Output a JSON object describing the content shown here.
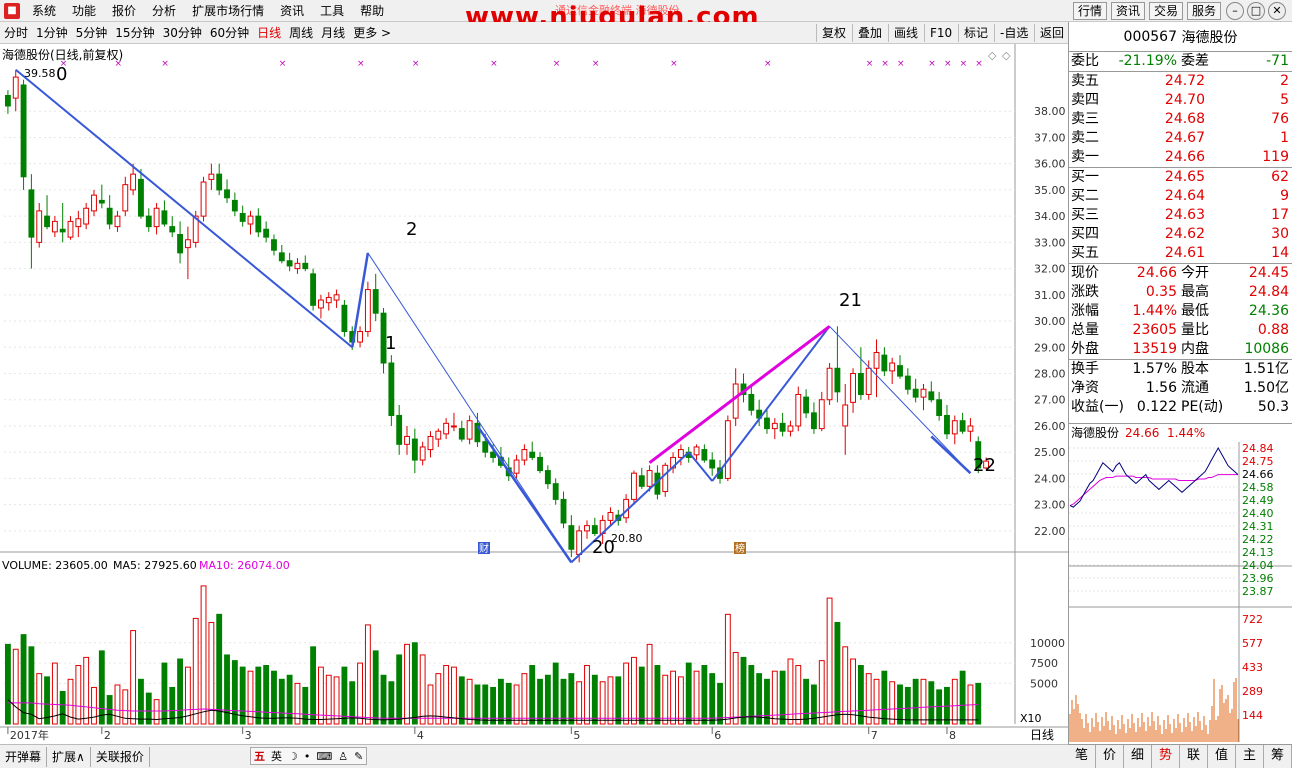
{
  "menu": {
    "items": [
      "系统",
      "功能",
      "报价",
      "分析",
      "扩展市场行情",
      "资讯",
      "工具",
      "帮助"
    ]
  },
  "watermark": "www.niugulan.com",
  "watermark_sub": "通达信金融终端   海德股份",
  "top_right": {
    "buttons": [
      "行情",
      "资讯",
      "交易",
      "服务"
    ]
  },
  "periods": {
    "items": [
      "分时",
      "1分钟",
      "5分钟",
      "15分钟",
      "30分钟",
      "60分钟",
      "日线",
      "周线",
      "月线",
      "更多 >"
    ],
    "active": "日线"
  },
  "toolbar": {
    "items": [
      "复权",
      "叠加",
      "画线",
      "F10",
      "标记",
      "-自选",
      "返回"
    ]
  },
  "chart": {
    "title": "海德股份(日线,前复权)",
    "high_label": "39.58",
    "low_label": "20.80",
    "y_ticks": [
      "38.00",
      "37.00",
      "36.00",
      "35.00",
      "34.00",
      "33.00",
      "32.00",
      "31.00",
      "30.00",
      "29.00",
      "28.00",
      "27.00",
      "26.00",
      "25.00",
      "24.00",
      "23.00",
      "22.00"
    ],
    "x_labels": [
      "2017年",
      "2",
      "3",
      "4",
      "5",
      "6",
      "7",
      "8"
    ],
    "wave_labels": [
      "0",
      "1",
      "2",
      "20",
      "21",
      "22"
    ],
    "volume_legend": {
      "vol": "VOLUME: 23605.00",
      "ma5": "MA5: 27925.60",
      "ma10": "MA10: 26074.00"
    },
    "volume_ticks": [
      "10000",
      "7500",
      "5000"
    ],
    "volume_unit": "X10",
    "period_label": "日线",
    "markers": {
      "cai": "财",
      "bang": "榜"
    },
    "colors": {
      "up": "#e00000",
      "down": "#008000",
      "wave": "#3858d8",
      "pink": "#e000e0",
      "ma5": "#000000",
      "ma10": "#e000e0"
    }
  },
  "chart_data": {
    "type": "candlestick",
    "ylim": [
      21.5,
      39.8
    ],
    "candles": [
      [
        38.6,
        38.8,
        37.9,
        38.2
      ],
      [
        38.5,
        39.58,
        38.0,
        39.3
      ],
      [
        39.0,
        39.2,
        35.0,
        35.5
      ],
      [
        35.0,
        35.6,
        32.0,
        33.2
      ],
      [
        33.0,
        34.5,
        32.8,
        34.2
      ],
      [
        34.0,
        34.8,
        33.5,
        33.6
      ],
      [
        33.4,
        34.0,
        33.2,
        33.8
      ],
      [
        33.5,
        34.5,
        33.0,
        33.4
      ],
      [
        33.2,
        34.0,
        33.1,
        33.8
      ],
      [
        33.6,
        34.2,
        33.2,
        33.9
      ],
      [
        33.7,
        34.5,
        33.5,
        34.3
      ],
      [
        34.2,
        35.0,
        34.0,
        34.8
      ],
      [
        34.6,
        35.2,
        34.3,
        34.5
      ],
      [
        34.3,
        34.8,
        33.5,
        33.7
      ],
      [
        33.6,
        34.2,
        33.4,
        34.0
      ],
      [
        34.2,
        35.5,
        34.0,
        35.2
      ],
      [
        35.0,
        36.0,
        34.8,
        35.6
      ],
      [
        35.4,
        35.8,
        33.9,
        34.0
      ],
      [
        34.0,
        34.3,
        33.4,
        33.6
      ],
      [
        33.6,
        34.5,
        33.3,
        34.3
      ],
      [
        34.2,
        34.6,
        33.6,
        33.7
      ],
      [
        33.6,
        34.0,
        33.2,
        33.4
      ],
      [
        33.3,
        33.8,
        32.2,
        32.6
      ],
      [
        32.8,
        33.6,
        31.6,
        33.1
      ],
      [
        33.0,
        34.2,
        32.8,
        34.0
      ],
      [
        34.0,
        35.5,
        33.8,
        35.3
      ],
      [
        35.4,
        36.0,
        35.0,
        35.6
      ],
      [
        35.6,
        36.0,
        34.8,
        35.0
      ],
      [
        35.0,
        35.4,
        34.5,
        34.7
      ],
      [
        34.6,
        34.9,
        34.0,
        34.2
      ],
      [
        34.1,
        34.4,
        33.6,
        33.8
      ],
      [
        33.7,
        34.2,
        33.3,
        34.0
      ],
      [
        34.0,
        34.3,
        33.2,
        33.4
      ],
      [
        33.5,
        33.8,
        33.0,
        33.2
      ],
      [
        33.1,
        33.3,
        32.5,
        32.7
      ],
      [
        32.6,
        32.9,
        32.2,
        32.3
      ],
      [
        32.3,
        32.6,
        31.9,
        32.1
      ],
      [
        32.0,
        32.4,
        31.8,
        32.2
      ],
      [
        32.2,
        32.5,
        31.9,
        32.0
      ],
      [
        31.8,
        32.0,
        30.4,
        30.6
      ],
      [
        30.5,
        31.0,
        30.1,
        30.8
      ],
      [
        30.7,
        31.1,
        30.4,
        30.9
      ],
      [
        30.8,
        31.2,
        30.5,
        31.0
      ],
      [
        30.6,
        30.8,
        29.4,
        29.6
      ],
      [
        29.6,
        29.8,
        28.9,
        29.2
      ],
      [
        29.2,
        29.8,
        29.0,
        29.6
      ],
      [
        29.6,
        31.5,
        29.4,
        31.2
      ],
      [
        31.2,
        31.8,
        30.0,
        30.3
      ],
      [
        30.3,
        30.5,
        28.0,
        28.4
      ],
      [
        28.4,
        28.7,
        26.0,
        26.4
      ],
      [
        26.4,
        26.8,
        24.9,
        25.3
      ],
      [
        25.3,
        26.0,
        24.9,
        25.6
      ],
      [
        25.5,
        25.9,
        24.2,
        24.7
      ],
      [
        24.7,
        25.4,
        24.5,
        25.2
      ],
      [
        25.1,
        25.8,
        24.8,
        25.6
      ],
      [
        25.5,
        25.9,
        25.2,
        25.8
      ],
      [
        25.7,
        26.3,
        25.5,
        26.1
      ],
      [
        26.0,
        26.5,
        25.8,
        26.0
      ],
      [
        25.9,
        26.2,
        25.4,
        25.5
      ],
      [
        25.5,
        26.4,
        25.3,
        26.2
      ],
      [
        26.1,
        26.5,
        25.2,
        25.4
      ],
      [
        25.4,
        25.7,
        24.8,
        25.0
      ],
      [
        25.0,
        25.3,
        24.6,
        24.8
      ],
      [
        24.8,
        25.2,
        24.4,
        24.5
      ],
      [
        24.4,
        24.8,
        23.9,
        24.1
      ],
      [
        24.2,
        24.9,
        24.0,
        24.7
      ],
      [
        24.7,
        25.3,
        24.5,
        25.1
      ],
      [
        25.0,
        25.4,
        24.7,
        24.8
      ],
      [
        24.8,
        25.0,
        24.2,
        24.3
      ],
      [
        24.3,
        24.5,
        23.6,
        23.8
      ],
      [
        23.8,
        24.0,
        23.0,
        23.2
      ],
      [
        23.2,
        23.5,
        22.1,
        22.3
      ],
      [
        22.2,
        22.6,
        21.0,
        21.3
      ],
      [
        21.1,
        22.2,
        20.8,
        22.0
      ],
      [
        22.0,
        22.4,
        21.7,
        22.2
      ],
      [
        22.2,
        22.5,
        21.8,
        21.9
      ],
      [
        21.9,
        22.6,
        21.5,
        22.4
      ],
      [
        22.4,
        22.9,
        22.2,
        22.7
      ],
      [
        22.6,
        22.8,
        22.2,
        22.4
      ],
      [
        22.5,
        23.4,
        22.3,
        23.2
      ],
      [
        23.2,
        24.3,
        23.0,
        24.2
      ],
      [
        24.1,
        24.4,
        23.6,
        23.7
      ],
      [
        23.7,
        24.5,
        23.5,
        24.3
      ],
      [
        24.2,
        24.5,
        23.2,
        23.4
      ],
      [
        23.5,
        24.6,
        23.3,
        24.5
      ],
      [
        24.4,
        25.0,
        24.2,
        24.8
      ],
      [
        24.8,
        25.3,
        24.5,
        25.1
      ],
      [
        25.0,
        25.2,
        24.6,
        24.8
      ],
      [
        24.9,
        25.3,
        24.7,
        25.2
      ],
      [
        25.1,
        25.3,
        24.6,
        24.7
      ],
      [
        24.7,
        25.0,
        24.1,
        24.4
      ],
      [
        24.4,
        24.7,
        23.8,
        24.0
      ],
      [
        24.0,
        26.4,
        23.9,
        26.2
      ],
      [
        26.3,
        28.2,
        26.0,
        27.6
      ],
      [
        27.6,
        28.0,
        26.9,
        27.2
      ],
      [
        27.2,
        27.5,
        26.4,
        26.6
      ],
      [
        26.6,
        27.0,
        26.0,
        26.3
      ],
      [
        26.3,
        26.7,
        25.7,
        25.9
      ],
      [
        25.9,
        26.3,
        25.5,
        26.1
      ],
      [
        26.1,
        26.5,
        25.6,
        25.8
      ],
      [
        25.8,
        26.2,
        25.6,
        26.0
      ],
      [
        26.0,
        27.5,
        25.8,
        27.2
      ],
      [
        27.1,
        27.4,
        26.3,
        26.5
      ],
      [
        26.5,
        26.9,
        25.7,
        25.9
      ],
      [
        25.9,
        27.3,
        25.8,
        27.0
      ],
      [
        27.0,
        28.4,
        26.8,
        28.2
      ],
      [
        28.2,
        29.8,
        26.9,
        27.3
      ],
      [
        26.0,
        27.6,
        24.9,
        26.8
      ],
      [
        26.9,
        28.2,
        26.5,
        28.0
      ],
      [
        28.0,
        29.0,
        27.0,
        27.2
      ],
      [
        27.2,
        28.5,
        27.0,
        28.2
      ],
      [
        28.2,
        29.3,
        27.1,
        28.8
      ],
      [
        28.7,
        29.0,
        27.9,
        28.1
      ],
      [
        28.1,
        28.6,
        27.6,
        28.4
      ],
      [
        28.3,
        28.7,
        27.8,
        27.9
      ],
      [
        27.9,
        28.2,
        27.2,
        27.4
      ],
      [
        27.4,
        27.8,
        26.9,
        27.1
      ],
      [
        27.1,
        27.6,
        26.6,
        27.4
      ],
      [
        27.3,
        27.7,
        26.9,
        27.0
      ],
      [
        27.0,
        27.3,
        26.2,
        26.4
      ],
      [
        26.4,
        26.8,
        25.5,
        25.7
      ],
      [
        25.7,
        26.4,
        25.3,
        26.2
      ],
      [
        26.2,
        26.5,
        25.7,
        25.8
      ],
      [
        25.8,
        26.3,
        25.4,
        26.0
      ],
      [
        25.4,
        25.6,
        24.2,
        24.4
      ],
      [
        24.4,
        24.8,
        24.36,
        24.66
      ]
    ],
    "volume": [
      98,
      92,
      110,
      95,
      62,
      58,
      75,
      40,
      55,
      72,
      82,
      45,
      90,
      35,
      48,
      42,
      115,
      55,
      38,
      30,
      75,
      45,
      80,
      70,
      130,
      170,
      125,
      135,
      85,
      78,
      70,
      65,
      70,
      72,
      65,
      55,
      60,
      50,
      45,
      95,
      70,
      60,
      58,
      70,
      52,
      75,
      122,
      90,
      60,
      52,
      85,
      98,
      100,
      85,
      48,
      62,
      72,
      70,
      58,
      55,
      48,
      48,
      45,
      55,
      50,
      48,
      62,
      72,
      55,
      60,
      75,
      55,
      62,
      52,
      72,
      60,
      52,
      58,
      58,
      75,
      82,
      70,
      98,
      72,
      60,
      65,
      58,
      75,
      65,
      72,
      62,
      50,
      135,
      88,
      82,
      72,
      62,
      55,
      65,
      65,
      80,
      72,
      55,
      48,
      78,
      155,
      125,
      95,
      80,
      72,
      62,
      55,
      65,
      52,
      48,
      45,
      55,
      55,
      52,
      42,
      45,
      55,
      65,
      48,
      50
    ],
    "ma5": [
      30.0,
      21.0,
      14.0,
      12.0,
      6.5,
      8.0,
      10.0,
      12.5,
      8.5,
      6.0,
      7.0,
      8.5,
      11.0,
      12.0,
      9.5,
      7.0,
      6.5,
      6.0,
      6.0,
      5.5,
      6.5,
      7.0,
      8.0,
      10.0,
      12.5,
      15.0,
      17.0,
      16.0,
      14.0,
      12.0,
      10.0,
      9.0,
      7.5,
      7.0,
      7.0,
      7.5,
      7.5,
      7.0,
      6.0,
      5.5,
      5.5,
      6.0,
      6.5,
      7.0,
      7.5,
      7.0,
      6.0,
      5.5,
      5.0,
      5.5,
      6.0,
      7.0,
      8.0,
      9.5,
      10.0,
      9.5,
      8.5,
      7.5,
      6.5,
      5.5,
      5.0,
      4.5,
      4.5,
      4.5,
      4.5,
      4.5,
      4.5,
      4.5,
      4.5,
      4.5,
      4.5,
      4.5,
      4.5,
      4.5,
      4.5,
      4.5,
      4.5,
      4.5,
      4.5,
      4.5,
      4.5,
      4.5,
      4.5,
      4.5,
      4.5,
      4.5,
      4.5,
      4.5,
      4.5,
      4.5,
      4.5,
      5.0,
      6.0,
      7.5,
      8.5,
      9.0,
      8.5,
      7.5,
      6.5,
      6.0,
      5.5,
      5.5,
      6.0,
      7.0,
      8.5,
      10.0,
      11.5,
      12.0,
      11.5,
      10.0,
      8.5,
      7.5,
      6.5,
      6.0,
      5.5,
      5.0,
      5.0,
      5.0,
      5.0,
      5.0,
      5.0,
      5.0,
      5.0,
      5.0,
      5.0
    ],
    "ma10": [
      26.0,
      26.0,
      26.0,
      26.0,
      25.0,
      24.5,
      24.0,
      23.5,
      23.0,
      22.0,
      21.0,
      20.0,
      19.0,
      18.0,
      17.0,
      16.5,
      16.0,
      16.0,
      16.0,
      16.0,
      16.0,
      16.5,
      17.0,
      17.5,
      18.0,
      18.5,
      18.0,
      17.5,
      17.0,
      16.5,
      16.0,
      15.5,
      15.0,
      14.5,
      14.0,
      13.5,
      13.0,
      12.5,
      12.0,
      11.5,
      11.0,
      10.5,
      10.0,
      9.5,
      9.0,
      8.5,
      8.0,
      7.5,
      7.0,
      7.0,
      7.0,
      7.0,
      7.0,
      7.0,
      7.0,
      7.0,
      7.0,
      7.0,
      7.0,
      7.0,
      7.0,
      7.0,
      7.0,
      7.0,
      7.0,
      7.0,
      7.0,
      7.0,
      7.0,
      7.0,
      7.0,
      7.0,
      7.0,
      7.0,
      7.0,
      7.0,
      7.0,
      7.0,
      7.0,
      7.0,
      7.0,
      7.0,
      7.0,
      7.0,
      7.0,
      7.0,
      7.0,
      7.0,
      7.0,
      7.0,
      7.0,
      7.5,
      8.0,
      8.5,
      9.0,
      9.5,
      10.0,
      10.5,
      11.0,
      11.5,
      12.0,
      12.5,
      13.0,
      13.5,
      14.0,
      14.5,
      15.0,
      15.5,
      16.0,
      16.5,
      17.0,
      17.5,
      18.0,
      18.5,
      19.0,
      19.5,
      20.0,
      20.5,
      21.0,
      21.5,
      22.0,
      22.5,
      23.0,
      23.5,
      24.0
    ],
    "intraday_price": [
      24.45,
      24.44,
      24.46,
      24.48,
      24.52,
      24.56,
      24.6,
      24.62,
      24.66,
      24.7,
      24.74,
      24.72,
      24.7,
      24.68,
      24.72,
      24.74,
      24.7,
      24.66,
      24.64,
      24.62,
      24.6,
      24.62,
      24.64,
      24.66,
      24.62,
      24.6,
      24.58,
      24.56,
      24.58,
      24.6,
      24.62,
      24.6,
      24.58,
      24.56,
      24.54,
      24.56,
      24.58,
      24.6,
      24.62,
      24.64,
      24.66,
      24.68,
      24.72,
      24.76,
      24.8,
      24.84,
      24.8,
      24.76,
      24.72,
      24.7,
      24.68,
      24.66
    ],
    "intraday_avg": [
      24.45,
      24.46,
      24.48,
      24.5,
      24.52,
      24.54,
      24.56,
      24.58,
      24.6,
      24.62,
      24.63,
      24.64,
      24.64,
      24.64,
      24.65,
      24.65,
      24.65,
      24.65,
      24.65,
      24.65,
      24.64,
      24.64,
      24.64,
      24.64,
      24.64,
      24.63,
      24.63,
      24.63,
      24.63,
      24.63,
      24.63,
      24.63,
      24.63,
      24.62,
      24.62,
      24.62,
      24.62,
      24.62,
      24.62,
      24.63,
      24.63,
      24.63,
      24.64,
      24.64,
      24.65,
      24.66,
      24.66,
      24.66,
      24.66,
      24.66,
      24.66,
      24.66
    ]
  },
  "quote": {
    "code": "000567",
    "name": "海德股份",
    "weibi_label": "委比",
    "weibi": "-21.19%",
    "weicha_label": "委差",
    "weicha": "-71",
    "sells": [
      {
        "label": "卖五",
        "price": "24.72",
        "vol": "2"
      },
      {
        "label": "卖四",
        "price": "24.70",
        "vol": "5"
      },
      {
        "label": "卖三",
        "price": "24.68",
        "vol": "76"
      },
      {
        "label": "卖二",
        "price": "24.67",
        "vol": "1"
      },
      {
        "label": "卖一",
        "price": "24.66",
        "vol": "119"
      }
    ],
    "buys": [
      {
        "label": "买一",
        "price": "24.65",
        "vol": "62"
      },
      {
        "label": "买二",
        "price": "24.64",
        "vol": "9"
      },
      {
        "label": "买三",
        "price": "24.63",
        "vol": "17"
      },
      {
        "label": "买四",
        "price": "24.62",
        "vol": "30"
      },
      {
        "label": "买五",
        "price": "24.61",
        "vol": "14"
      }
    ],
    "stats": [
      {
        "l1": "现价",
        "v1": "24.66",
        "l2": "今开",
        "v2": "24.45",
        "c1": "red",
        "c2": "red"
      },
      {
        "l1": "涨跌",
        "v1": "0.35",
        "l2": "最高",
        "v2": "24.84",
        "c1": "red",
        "c2": "red"
      },
      {
        "l1": "涨幅",
        "v1": "1.44%",
        "l2": "最低",
        "v2": "24.36",
        "c1": "red",
        "c2": "grn"
      },
      {
        "l1": "总量",
        "v1": "23605",
        "l2": "量比",
        "v2": "0.88",
        "c1": "red",
        "c2": "red"
      },
      {
        "l1": "外盘",
        "v1": "13519",
        "l2": "内盘",
        "v2": "10086",
        "c1": "red",
        "c2": "grn"
      }
    ],
    "stats2": [
      {
        "l1": "换手",
        "v1": "1.57%",
        "l2": "股本",
        "v2": "1.51亿"
      },
      {
        "l1": "净资",
        "v1": "1.56",
        "l2": "流通",
        "v2": "1.50亿"
      },
      {
        "l1": "收益(一)",
        "v1": "0.122",
        "l2": "PE(动)",
        "v2": "50.3"
      }
    ]
  },
  "mini": {
    "name": "海德股份",
    "price": "24.66",
    "pct": "1.44%",
    "price_ticks": [
      "24.84",
      "24.75",
      "24.66",
      "24.58",
      "24.49",
      "24.40",
      "24.31",
      "24.22",
      "24.13",
      "24.04",
      "23.96",
      "23.87"
    ],
    "vol_ticks": [
      "722",
      "577",
      "433",
      "289",
      "144"
    ]
  },
  "bottom": {
    "left": [
      "开弹幕",
      "扩展∧",
      "关联报价"
    ],
    "tabs": [
      "笔",
      "价",
      "细",
      "势",
      "联",
      "值",
      "主",
      "筹"
    ],
    "active_tab": "势",
    "tray": "英"
  }
}
